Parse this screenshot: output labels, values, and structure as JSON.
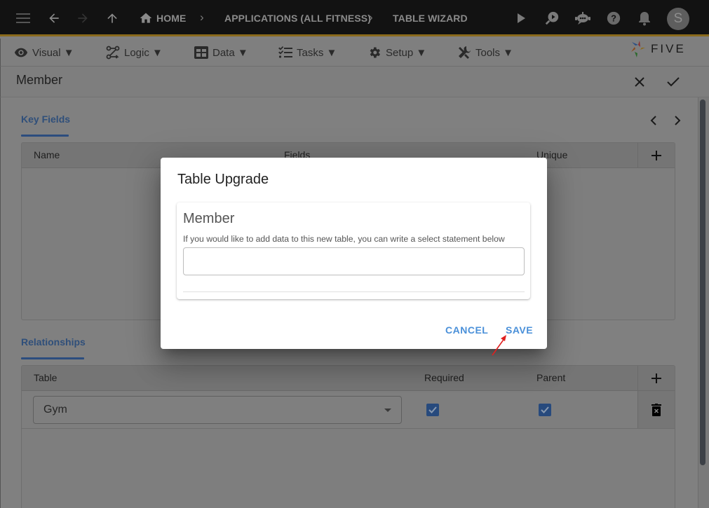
{
  "topbar": {
    "breadcrumbs": [
      "HOME",
      "APPLICATIONS (ALL FITNESS)",
      "TABLE WIZARD"
    ],
    "avatar_initial": "S",
    "icons": [
      "menu-icon",
      "back-arrow-icon",
      "forward-arrow-icon",
      "up-arrow-icon",
      "home-icon",
      "play-icon",
      "search-play-icon",
      "chatbot-icon",
      "help-icon",
      "bell-icon"
    ]
  },
  "menubar": {
    "items": [
      {
        "label": "Visual ▼",
        "icon": "eye-icon"
      },
      {
        "label": "Logic ▼",
        "icon": "flow-icon"
      },
      {
        "label": "Data ▼",
        "icon": "table-icon"
      },
      {
        "label": "Tasks ▼",
        "icon": "checklist-icon"
      },
      {
        "label": "Setup ▼",
        "icon": "gear-icon"
      },
      {
        "label": "Tools ▼",
        "icon": "tools-icon"
      }
    ],
    "logo_text": "FIVE"
  },
  "form": {
    "title": "Member",
    "key_fields": {
      "tab_label": "Key Fields",
      "columns": [
        "Name",
        "Fields",
        "Unique"
      ],
      "rows": []
    },
    "relationships": {
      "tab_label": "Relationships",
      "columns": [
        "Table",
        "Required",
        "Parent"
      ],
      "rows": [
        {
          "table": "Gym",
          "required": true,
          "parent": true
        }
      ]
    }
  },
  "dialog": {
    "title": "Table Upgrade",
    "card_title": "Member",
    "description": "If you would like to add data to this new table, you can write a select statement below",
    "input_value": "",
    "cancel_label": "CANCEL",
    "save_label": "SAVE"
  },
  "colors": {
    "accent": "#4a90d9",
    "topbar_border": "#8a6a1c",
    "checkbox": "#274a7d"
  }
}
